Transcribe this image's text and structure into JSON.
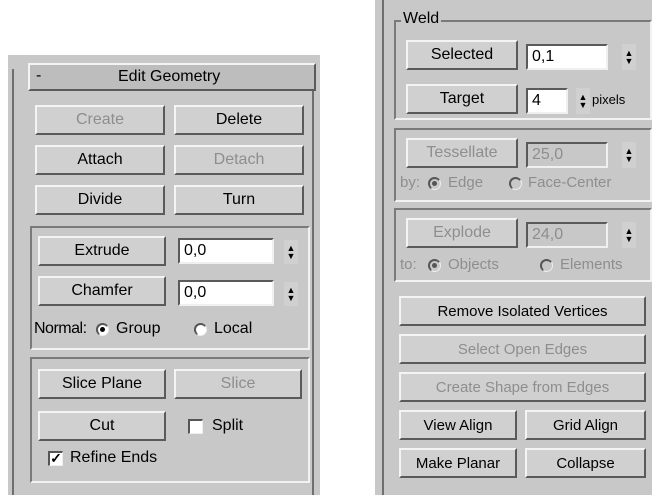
{
  "left_panel": {
    "rollout": {
      "toggle": "-",
      "title": "Edit Geometry"
    },
    "create": "Create",
    "delete": "Delete",
    "attach": "Attach",
    "detach": "Detach",
    "divide": "Divide",
    "turn": "Turn",
    "extrude": {
      "label": "Extrude",
      "value": "0,0"
    },
    "chamfer": {
      "label": "Chamfer",
      "value": "0,0"
    },
    "normal": {
      "label": "Normal:",
      "group": "Group",
      "local": "Local",
      "selected": "group"
    },
    "slice_plane": "Slice Plane",
    "slice": "Slice",
    "cut": "Cut",
    "split": {
      "label": "Split",
      "checked": false
    },
    "refine_ends": {
      "label": "Refine Ends",
      "checked": true,
      "mark": "✓"
    }
  },
  "right_panel": {
    "weld": {
      "group_label": "Weld",
      "selected_button": "Selected",
      "selected_value": "0,1",
      "target_button": "Target",
      "target_value": "4",
      "target_unit": "pixels"
    },
    "tessellate": {
      "button": "Tessellate",
      "value": "25,0",
      "by_label": "by:",
      "edge": "Edge",
      "face_center": "Face-Center",
      "selected": "edge"
    },
    "explode": {
      "button": "Explode",
      "value": "24,0",
      "to_label": "to:",
      "objects": "Objects",
      "elements": "Elements",
      "selected": "objects"
    },
    "remove_isolated_vertices": "Remove Isolated Vertices",
    "select_open_edges": "Select Open Edges",
    "create_shape_from_edges": "Create Shape from Edges",
    "view_align": "View Align",
    "grid_align": "Grid Align",
    "make_planar": "Make Planar",
    "collapse": "Collapse"
  }
}
